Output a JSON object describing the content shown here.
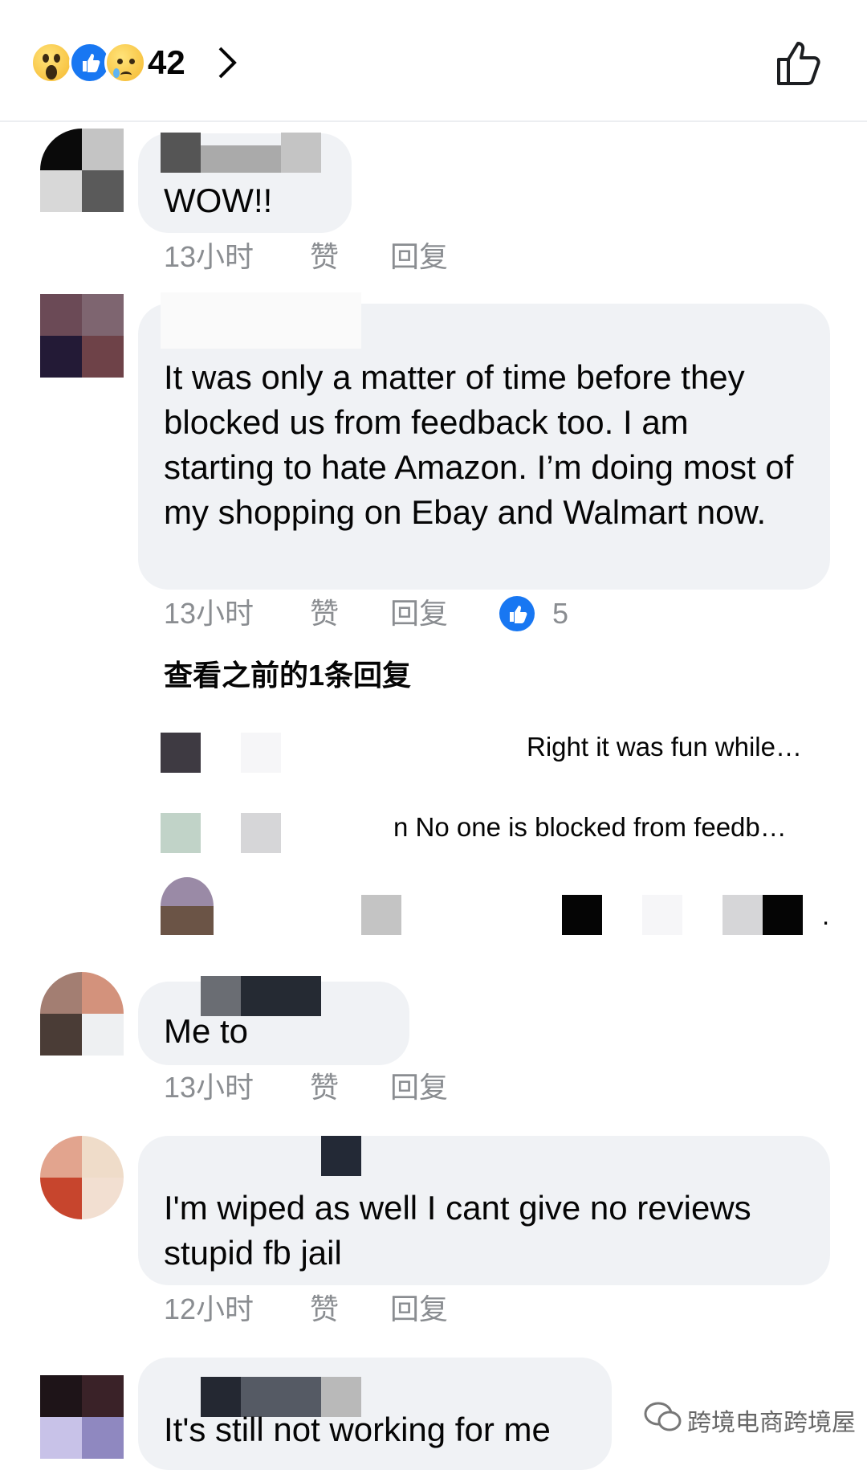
{
  "reactions": {
    "count": "42",
    "icons": [
      "wow-icon",
      "like-icon",
      "sad-icon"
    ],
    "like_color": "#1877f2"
  },
  "comments": [
    {
      "text": "WOW!!",
      "time": "13小时",
      "like": "赞",
      "reply": "回复"
    },
    {
      "text": "It was only a matter of time before they blocked us from feedback too. I am starting to hate Amazon. I’m doing most of my shopping on Ebay and Walmart now.",
      "time": "13小时",
      "like": "赞",
      "reply": "回复",
      "like_count": "5",
      "view_previous": "查看之前的1条回复"
    },
    {
      "text": "Me to",
      "time": "13小时",
      "like": "赞",
      "reply": "回复"
    },
    {
      "text": "I'm wiped as well I cant give no reviews stupid fb jail",
      "time": "12小时",
      "like": "赞",
      "reply": "回复"
    },
    {
      "text": "It's still not working for me"
    }
  ],
  "replies": [
    {
      "preview": "Right it was fun while…"
    },
    {
      "preview": "n No one is blocked from feedb…"
    },
    {
      "preview": "."
    }
  ],
  "watermark": "跨境电商跨境屋"
}
